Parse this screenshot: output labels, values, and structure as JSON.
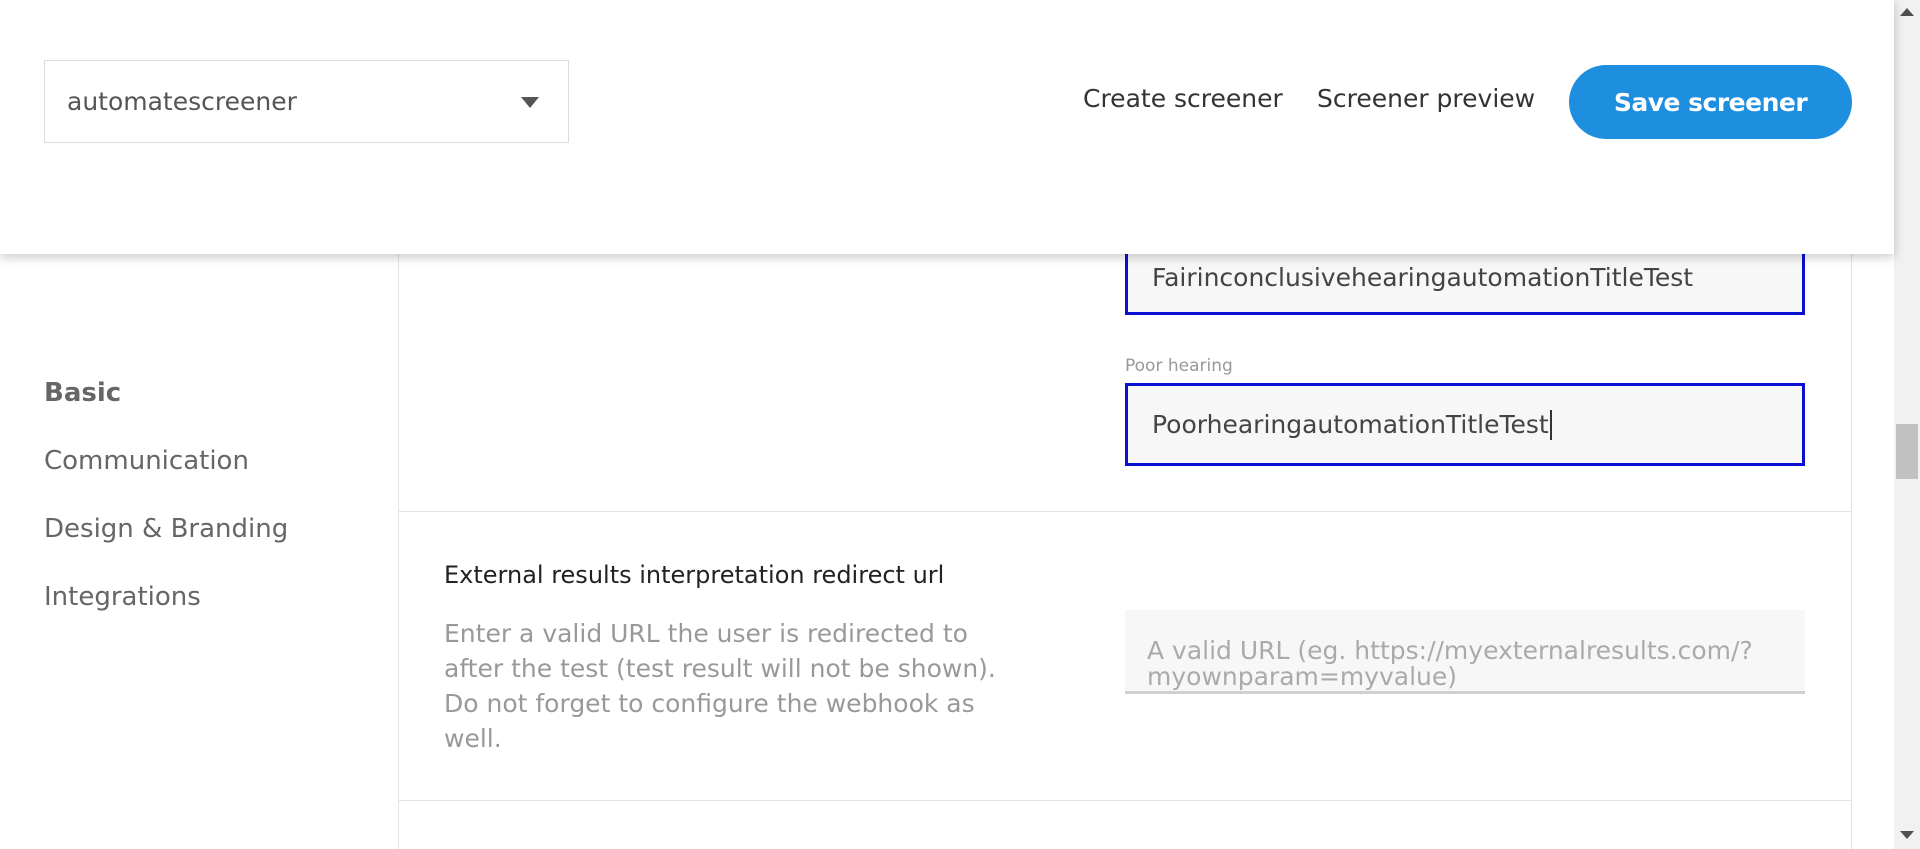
{
  "header": {
    "screener_select": {
      "value": "automatescreener"
    },
    "nav": {
      "create_screener": "Create screener",
      "screener_preview": "Screener preview"
    },
    "save_label": "Save screener"
  },
  "sidebar": {
    "items": [
      {
        "label": "Basic",
        "active": true
      },
      {
        "label": "Communication",
        "active": false
      },
      {
        "label": "Design & Branding",
        "active": false
      },
      {
        "label": "Integrations",
        "active": false
      }
    ]
  },
  "result_titles": {
    "fair_inconclusive_value": "FairinconclusivehearingautomationTitleTest",
    "poor_hearing_label": "Poor hearing",
    "poor_hearing_value": "PoorhearingautomationTitleTest"
  },
  "external_redirect": {
    "title": "External results interpretation redirect url",
    "description": "Enter a valid URL the user is redirected to after the test (test result will not be shown). Do not forget to configure the webhook as well.",
    "placeholder": "A valid URL (eg. https://myexternalresults.com/?myownparam=myvalue)"
  },
  "colors": {
    "accent": "#1e8ede",
    "focus_border": "#0a10d2"
  }
}
